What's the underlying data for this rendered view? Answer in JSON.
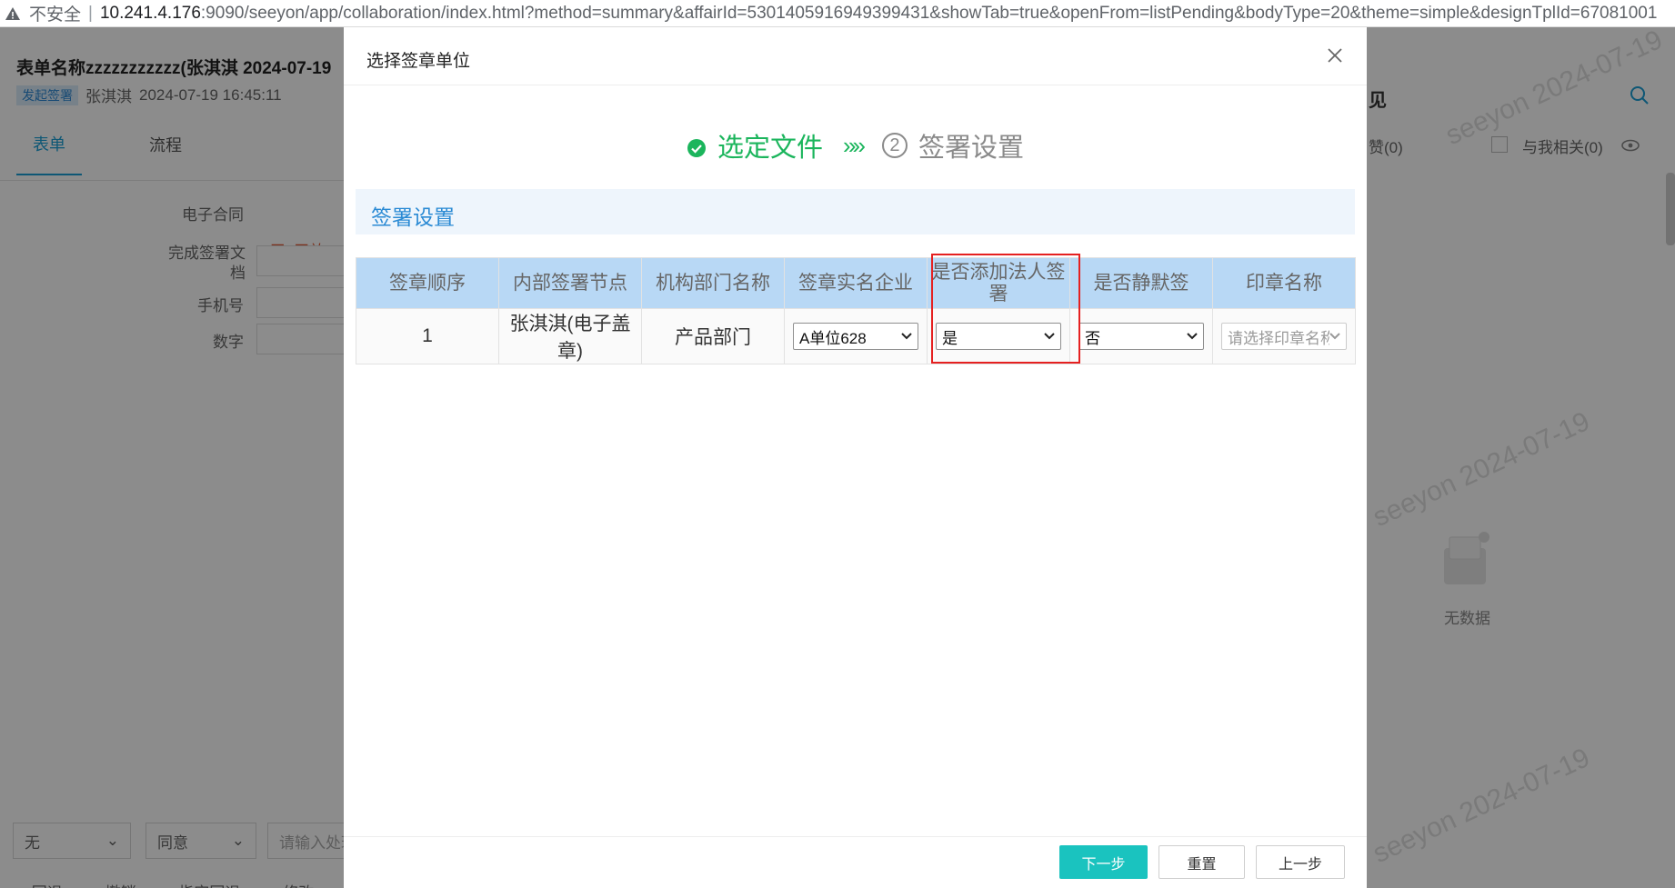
{
  "browser": {
    "insecure_label": "不安全",
    "url_host": "10.241.4.176",
    "url_rest": ":9090/seeyon/app/collaboration/index.html?method=summary&affairId=5301405916949399431&showTab=true&openFrom=listPending&bodyType=20&theme=simple&designTplId=67081001"
  },
  "background": {
    "title": "表单名称zzzzzzzzzzz(张淇淇 2024-07-19",
    "badge": "发起签署",
    "author": "张淇淇",
    "datetime": "2024-07-19 16:45:11",
    "tabs": [
      "表单",
      "流程"
    ],
    "form_labels": [
      "电子合同",
      "完成签署文档",
      "手机号",
      "数字"
    ],
    "file_text": "[无] 无效",
    "right_title": "见",
    "likes": "赞(0)",
    "related": "与我相关(0)",
    "watermark": "seeyon 2024-07-19",
    "nodata": "无数据",
    "bottom_select_1": "无",
    "bottom_select_2": "同意",
    "bottom_input_placeholder": "请输入处理",
    "bottom_actions": [
      "回退",
      "撤销",
      "指定回退",
      "修改"
    ]
  },
  "modal": {
    "title": "选择签章单位",
    "steps": {
      "step1": "选定文件",
      "arrows": "»»",
      "step2_num": "2",
      "step2": "签署设置"
    },
    "section_title": "签署设置",
    "table": {
      "headers": [
        "签章顺序",
        "内部签署节点",
        "机构部门名称",
        "签章实名企业",
        "是否添加法人签署",
        "是否静默签",
        "印章名称"
      ],
      "rows": [
        {
          "order": "1",
          "node": "张淇淇(电子盖章)",
          "dept": "产品部门",
          "company": "A单位628",
          "add_legal": "是",
          "silent": "否",
          "seal_placeholder": "请选择印章名称"
        }
      ]
    },
    "buttons": {
      "next": "下一步",
      "reset": "重置",
      "prev": "上一步"
    }
  },
  "colors": {
    "primary": "#1ac3bf",
    "success": "#1bb55c",
    "header_bg": "#b8d8f5",
    "section_bg": "#eef5fc",
    "highlight": "#e52020"
  }
}
